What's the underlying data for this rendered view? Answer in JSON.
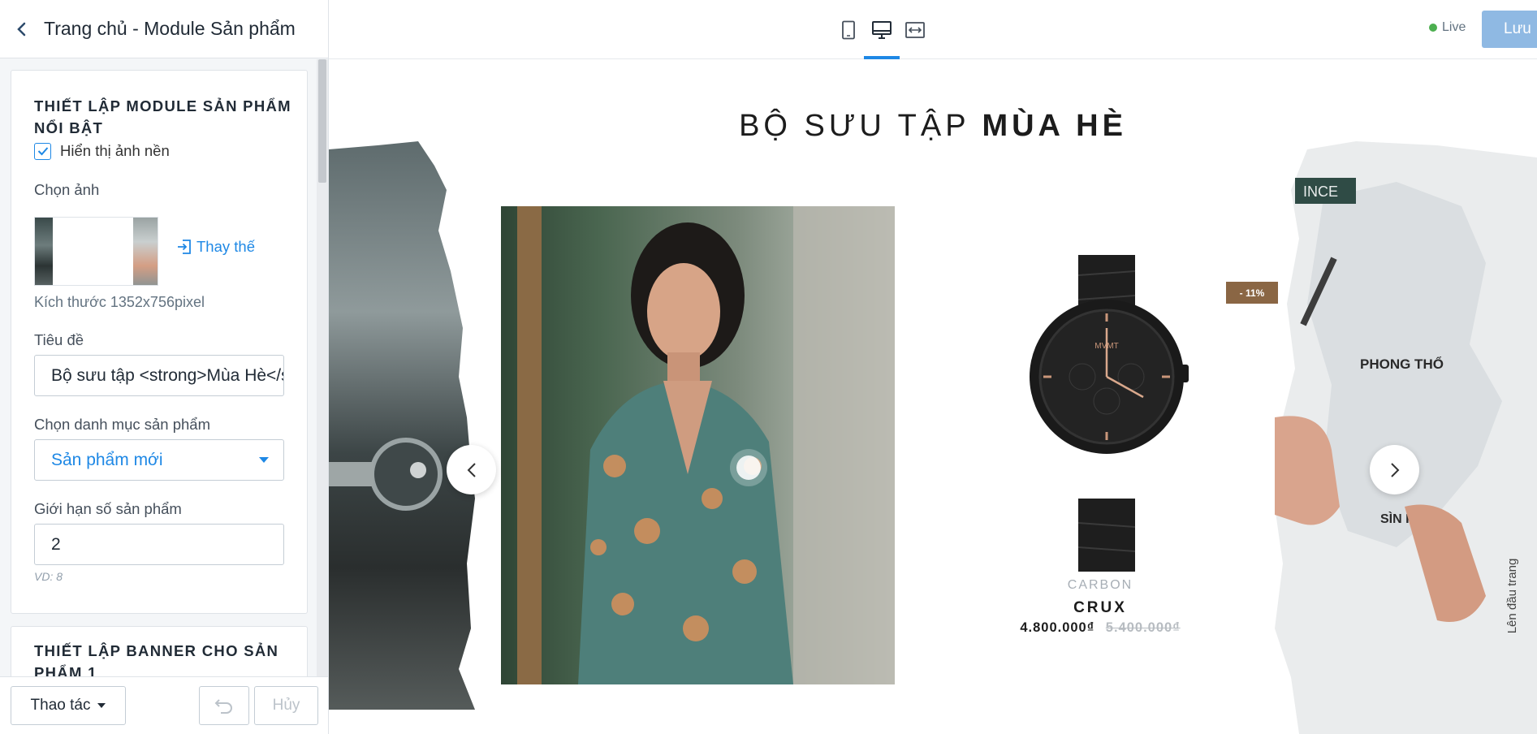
{
  "sidebar": {
    "header_title": "Trang chủ - Module Sản phẩm",
    "card1": {
      "title": "THIẾT LẬP MODULE SẢN PHẨM NỔI BẬT",
      "show_bg_label": "Hiển thị ảnh nền",
      "show_bg_checked": true,
      "choose_image_label": "Chọn ảnh",
      "replace_label": "Thay thế",
      "size_hint": "Kích thước 1352x756pixel",
      "title_label": "Tiêu đề",
      "title_value": "Bộ sưu tập <strong>Mùa Hè</strong>",
      "category_label": "Chọn danh mục sản phẩm",
      "category_value": "Sản phẩm mới",
      "limit_label": "Giới hạn số sản phẩm",
      "limit_value": "2",
      "limit_hint": "VD: 8"
    },
    "card2": {
      "title": "THIẾT LẬP BANNER CHO SẢN PHẨM 1"
    },
    "footer": {
      "actions_label": "Thao tác",
      "cancel_label": "Hủy"
    }
  },
  "topbar": {
    "devices": [
      "mobile-icon",
      "desktop-icon",
      "fullwidth-icon"
    ],
    "active_device": "desktop",
    "live_label": "Live",
    "save_label": "Lưu",
    "accent_color": "#1e88e5"
  },
  "preview": {
    "section_title_light": "BỘ SƯU TẬP",
    "section_title_bold": "MÙA HÈ",
    "product": {
      "badge": "- 11%",
      "brand": "CARBON",
      "name": "CRUX",
      "price": "4.800.000₫",
      "old_price": "5.400.000₫",
      "dial_brand": "MVMT"
    },
    "map_labels": {
      "place1": "PHONG THỔ",
      "place2": "SÌN HỒ",
      "corner": "INCE"
    },
    "back_to_top": "Lên đầu trang"
  }
}
